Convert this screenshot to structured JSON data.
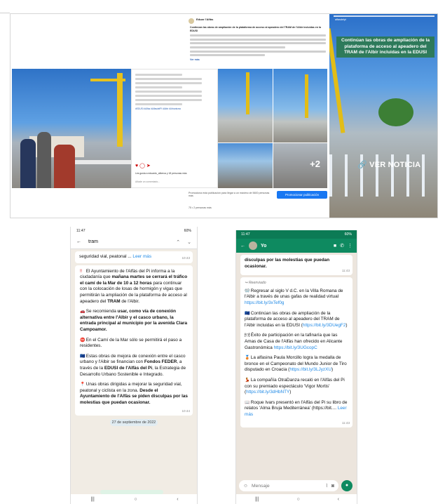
{
  "facebook_post": {
    "page_name": "Eduar l'Alfàs",
    "headline": "Continúan las obras de ampliación de la plataforma de acceso al apeadero del TRAM de l'Albir incluidas en la EDUSI",
    "see_more": "Ver más",
    "promote_button": "Promocionar publicación",
    "promote_text": "Promociona esta publicación para llegar a un máximo de 5600 personas más",
    "views": "75 • 2 personas más"
  },
  "instagram_post": {
    "likes": "Les gusta a eduardo_alberca y 18 personas más",
    "comment_placeholder": "Añade un comentario...",
    "tags": "#EDUSI #Alfàs #AlfasdelPi #Albir #Urbanismo"
  },
  "photo_grid": {
    "more_count": "+2"
  },
  "story": {
    "account": "alfasdelpi",
    "headline": "Continúan las obras de ampliación de la plataforma de acceso al apeadero del TRAM de l'Albir incluidas en la EDUSI",
    "cta": "VER NOTICIA",
    "cta_icon": "link-icon"
  },
  "phone1": {
    "status_time": "11:47",
    "status_right": "60%",
    "search_query": "tram",
    "prev_message_tail": "seguridad vial, peatonal ...",
    "prev_more": "Leer más",
    "prev_time": "10:43",
    "p1_a": "El Ayuntamiento de l'Alfàs del Pi informa a la ciudadanía que ",
    "p1_b": "mañana martes se cerrará el tráfico el camí de la Mar de 10 a 12 horas",
    "p1_c": " para continuar con la colocación de losas de hormigón y vigas que permitirán la ampliación de la plataforma de acceso al apeadero del ",
    "p1_hl": "TRAM",
    "p1_d": " de l'Albir.",
    "p2_a": "Se recomienda ",
    "p2_b": "usar, como vía de conexión alternativa entre l'Albir y el casco urbano, la entrada principal al municipio por la avenida Clara Campoamor.",
    "p3_a": "En el Camí de la Mar sólo se permitirá el paso a residentes.",
    "p4_a": "Estas obras de mejora de conexión entre el casco urbano y l'Albir se financian con ",
    "p4_b": "Fondos FEDER",
    "p4_c": ", a través de la ",
    "p4_d": "EDUSI de l'Alfàs del Pi",
    "p4_e": ", la Estrategia de Desarrollo Urbano Sostenible e Integrado.",
    "p5_a": "Unas obras dirigidas a mejorar la seguridad vial, peatonal y ciclista en la zona. ",
    "p5_b": "Desde el Ayuntamiento de l'Alfàs se piden disculpas por las molestias que puedan ocasionar.",
    "main_time": "10:44",
    "date_chip": "27 de septiembre de 2022"
  },
  "phone2": {
    "status_time": "11:47",
    "status_right": "60%",
    "contact_name": "Yo",
    "top_tail": "disculpas por las molestias que puedan ocasionar.",
    "top_time": "11:43",
    "forwarded": "Reenviado",
    "m1": "Regresar al siglo V d.C. en la Villa Romana de l'Albir a través de unas gafas de realidad virtual ",
    "m1_link": "https://bit.ly/3xTef0g",
    "m2": "Continúan las obras de ampliación de la plataforma de acceso al apeadero del TRAM de l'Albir incluidas en la EDUSI (",
    "m2_link": "https://bit.ly/3DUegF2",
    "m2_end": ")",
    "m3": "Éxito de participación en la tafinaría que las Amas de Casa de l'Alfàs han ofrecido en Alicante Gastronómica ",
    "m3_link": "https://bit.ly/3UGcopC",
    "m4": "La alfasina Paula Morcillo logra la medalla de bronce en el Campeonato del Mundo Junior de Tiro disputado en Croacia (",
    "m4_link": "https://bit.ly/3LJyzXU",
    "m4_end": ")",
    "m5": "La compañía OtraDanza recaló en l'Alfàs del Pi con su premiado espectáculo 'Vigor Mortis' (",
    "m5_link": "https://bit.ly/3dHbNTY",
    "m5_end": ")",
    "m6": "Roque Ivars presentó en l'Alfàs del Pi su libro de relatos 'Alma Bruja Mediterránea' (https://bit....",
    "m6_more": "Leer más",
    "bottom_time": "11:43",
    "input_placeholder": "Mensaje"
  }
}
